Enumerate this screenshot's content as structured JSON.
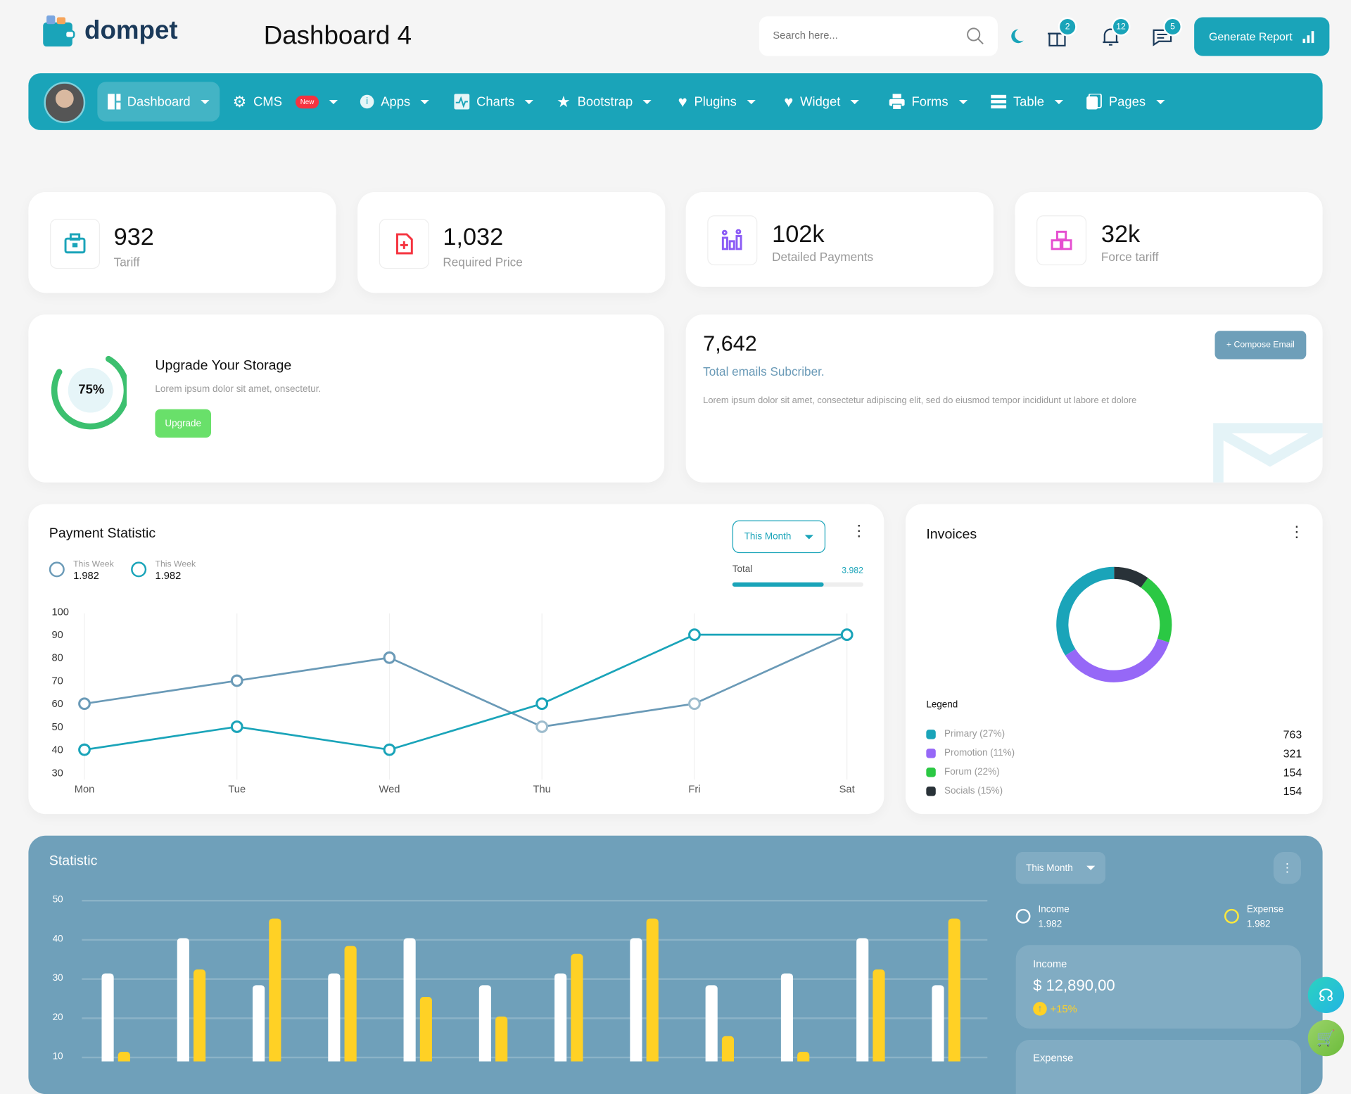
{
  "header": {
    "brand": "dompet",
    "title": "Dashboard 4",
    "search_placeholder": "Search here...",
    "gift_count": "2",
    "bell_count": "12",
    "chat_count": "5",
    "generate_report": "Generate Report"
  },
  "nav": {
    "items": [
      {
        "label": "Dashboard"
      },
      {
        "label": "CMS",
        "badge": "New"
      },
      {
        "label": "Apps"
      },
      {
        "label": "Charts"
      },
      {
        "label": "Bootstrap"
      },
      {
        "label": "Plugins"
      },
      {
        "label": "Widget"
      },
      {
        "label": "Forms"
      },
      {
        "label": "Table"
      },
      {
        "label": "Pages"
      }
    ]
  },
  "stats": [
    {
      "value": "932",
      "label": "Tariff",
      "color": "#1aa4b9"
    },
    {
      "value": "1,032",
      "label": "Required Price",
      "color": "#f5333f"
    },
    {
      "value": "102k",
      "label": "Detailed Payments",
      "color": "#8c5cf5"
    },
    {
      "value": "32k",
      "label": "Force tariff",
      "color": "#e54fd0"
    }
  ],
  "storage": {
    "percent": "75%",
    "progress": 0.75,
    "title": "Upgrade Your Storage",
    "text": "Lorem ipsum dolor sit amet, onsectetur.",
    "button": "Upgrade"
  },
  "email": {
    "count": "7,642",
    "subtitle": "Total emails Subcriber.",
    "text": "Lorem ipsum dolor sit amet, consectetur adipiscing elit, sed do eiusmod tempor incididunt ut labore et dolore",
    "button": "+ Compose Email"
  },
  "payment": {
    "title": "Payment Statistic",
    "filter": "This Month",
    "legend": [
      {
        "label": "This Week",
        "value": "1.982"
      },
      {
        "label": "This Week",
        "value": "1.982"
      }
    ],
    "total_label": "Total",
    "total_value": "3.982",
    "total_progress": 0.7
  },
  "chart_data": [
    {
      "type": "line",
      "categories": [
        "Mon",
        "Tue",
        "Wed",
        "Thu",
        "Fri",
        "Sat"
      ],
      "ylim": [
        30,
        100
      ],
      "yticks": [
        "100",
        "90",
        "80",
        "70",
        "60",
        "50",
        "40",
        "30"
      ],
      "series": [
        {
          "values": [
            60,
            70,
            80,
            50,
            60,
            90
          ],
          "color": "#6a9ab7"
        },
        {
          "values": [
            40,
            50,
            40,
            60,
            90,
            90
          ],
          "color": "#1aa4b9"
        }
      ]
    },
    {
      "type": "pie",
      "title": "Invoices",
      "series": [
        {
          "name": "Socials",
          "fraction": 0.1,
          "color": "#293238"
        },
        {
          "name": "Forum",
          "fraction": 0.2,
          "color": "#2bc844"
        },
        {
          "name": "Promotion",
          "fraction": 0.36,
          "color": "#9668f7"
        },
        {
          "name": "Primary",
          "fraction": 0.34,
          "color": "#1aa4b9"
        }
      ]
    },
    {
      "type": "bar",
      "title": "Statistic",
      "yticks": [
        "50",
        "40",
        "30",
        "20",
        "10"
      ],
      "ylim": [
        0,
        50
      ],
      "series": [
        {
          "name": "Income",
          "color": "#ffffff",
          "values": [
            31,
            40,
            28,
            31,
            40,
            28,
            31,
            40,
            28,
            31,
            40,
            28
          ]
        },
        {
          "name": "Expense",
          "color": "#ffd125",
          "values": [
            11,
            32,
            45,
            38,
            25,
            20,
            36,
            45,
            15,
            11,
            32,
            45
          ]
        }
      ]
    }
  ],
  "invoices": {
    "title": "Invoices",
    "legend_title": "Legend",
    "items": [
      {
        "label": "Primary (27%)",
        "value": "763",
        "color": "#1aa4b9"
      },
      {
        "label": "Promotion (11%)",
        "value": "321",
        "color": "#9668f7"
      },
      {
        "label": "Forum (22%)",
        "value": "154",
        "color": "#2bc844"
      },
      {
        "label": "Socials (15%)",
        "value": "154",
        "color": "#293238"
      }
    ]
  },
  "statistic": {
    "title": "Statistic",
    "filter": "This Month",
    "income_label": "Income",
    "income_value": "1.982",
    "expense_label": "Expense",
    "expense_value": "1.982",
    "income_card_label": "Income",
    "income_amount": "$ 12,890,00",
    "income_change": "+15%",
    "expense_card_label": "Expense"
  }
}
